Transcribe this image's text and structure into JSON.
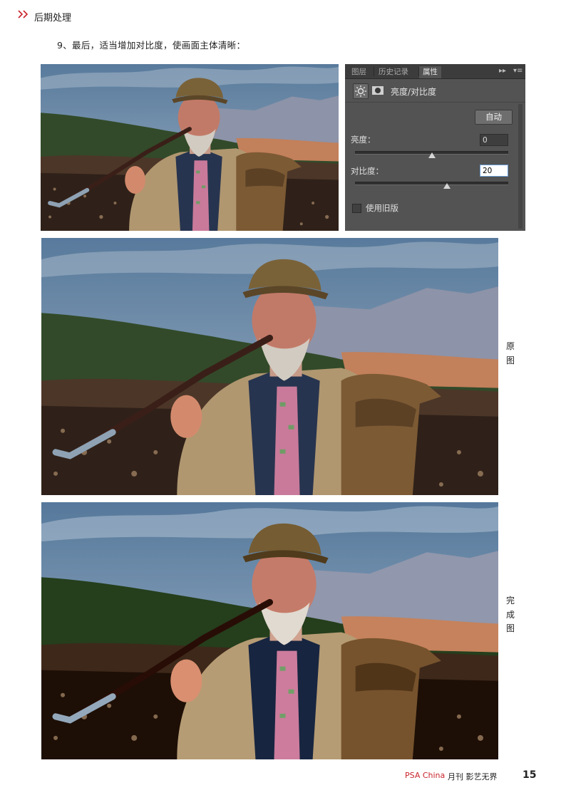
{
  "header": {
    "icon": "double-chevron-right-icon",
    "title": "后期处理"
  },
  "step_text": "9、最后，适当增加对比度，使画面主体清晰：",
  "panel": {
    "tabs": [
      "图层",
      "历史记录",
      "属性"
    ],
    "active_tab": "属性",
    "title": "亮度/对比度",
    "auto_button": "自动",
    "brightness": {
      "label": "亮度：",
      "value": "0",
      "level_percent": 50
    },
    "contrast": {
      "label": "对比度：",
      "value": "20",
      "level_percent": 60
    },
    "legacy_checkbox": {
      "label": "使用旧版",
      "checked": false
    }
  },
  "labels": {
    "original": [
      "原",
      "图"
    ],
    "final": [
      "完",
      "成",
      "图"
    ]
  },
  "footer": {
    "brand": "PSA China",
    "magazine": "月刊  影艺无界",
    "page": "15"
  },
  "colors": {
    "brand_red": "#c8242b",
    "panel_bg": "#535353"
  }
}
